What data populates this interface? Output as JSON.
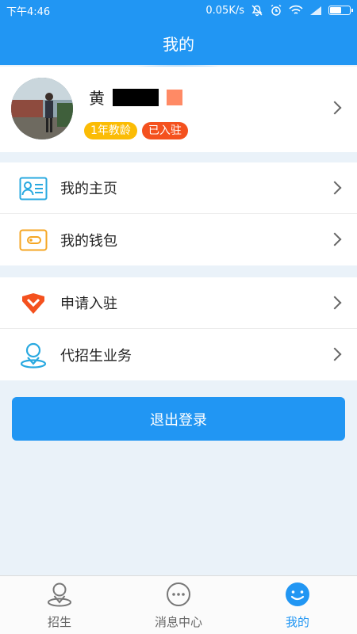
{
  "status_bar": {
    "time": "下午4:46",
    "network_speed": "0.05K/s",
    "battery_level": 0.6
  },
  "header": {
    "title": "我的"
  },
  "profile": {
    "name_visible": "黄",
    "tags": [
      "1年教龄",
      "已入驻"
    ]
  },
  "menu_group_1": [
    {
      "label": "我的主页",
      "icon": "id-card-icon"
    },
    {
      "label": "我的钱包",
      "icon": "wallet-icon"
    }
  ],
  "menu_group_2": [
    {
      "label": "申请入驻",
      "icon": "badge-icon"
    },
    {
      "label": "代招生业务",
      "icon": "person-pin-icon"
    }
  ],
  "logout_label": "退出登录",
  "tabbar": [
    {
      "label": "招生",
      "icon": "person-pin-icon",
      "active": false
    },
    {
      "label": "消息中心",
      "icon": "chat-bubble-icon",
      "active": false
    },
    {
      "label": "我的",
      "icon": "smiley-icon",
      "active": true
    }
  ],
  "colors": {
    "primary": "#2196f3",
    "tag_yellow": "#fbbc05",
    "tag_orange": "#f4511e"
  }
}
